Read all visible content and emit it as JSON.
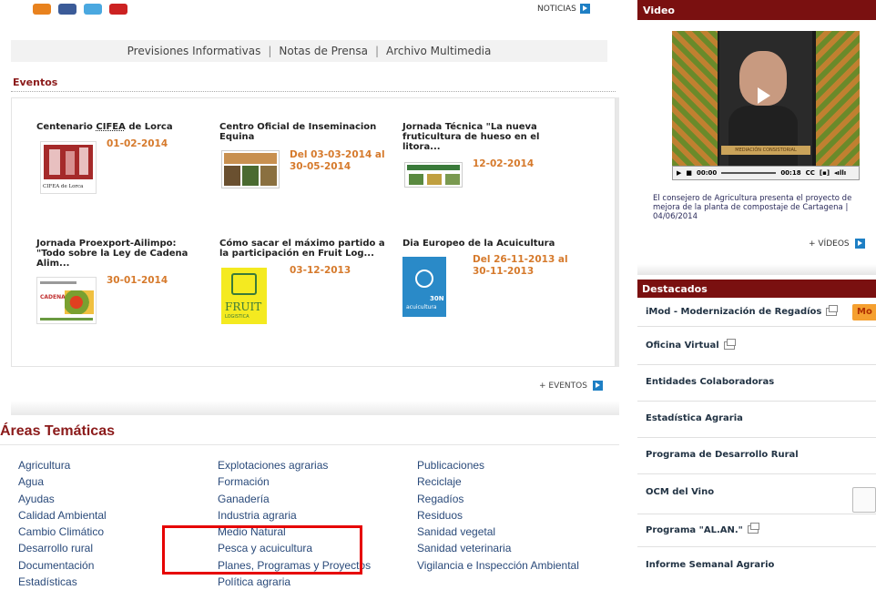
{
  "nav": {
    "items": [
      "Previsiones Informativas",
      "Notas de Prensa",
      "Archivo Multimedia"
    ],
    "sep": "|"
  },
  "top_right": {
    "label": "NOTICIAS"
  },
  "eventos": {
    "title": "Eventos",
    "items": [
      {
        "title_a": "Centenario ",
        "title_u": "CIFEA",
        "title_b": " de Lorca",
        "date": "01-02-2014"
      },
      {
        "title": "Centro Oficial de Inseminacion Equina",
        "date": "Del 03-03-2014 al 30-05-2014"
      },
      {
        "title": "Jornada Técnica \"La nueva fruticultura de hueso en el litora...",
        "date": "12-02-2014"
      },
      {
        "title": "Jornada Proexport-Ailimpo: \"Todo sobre la Ley de Cadena Alim...",
        "date": "30-01-2014"
      },
      {
        "title": "Cómo sacar el máximo partido a la participación en Fruit Log...",
        "date": "03-12-2013"
      },
      {
        "title": "Dia Europeo de la Acuicultura",
        "date": "Del 26-11-2013 al 30-11-2013"
      }
    ],
    "more": "+ EVENTOS"
  },
  "thumbs": {
    "cifea": "CIFEA de Lorca",
    "fruit": "FRUIT",
    "logistica": "LOGISTICA",
    "acui_num": "30N",
    "acui_word": "acuicultura",
    "cadena": "CADENA"
  },
  "areas": {
    "title": "Áreas Temáticas",
    "col1": [
      "Agricultura",
      "Agua",
      "Ayudas",
      "Calidad Ambiental",
      "Cambio Climático",
      "Desarrollo rural",
      "Documentación",
      "Estadísticas"
    ],
    "col2": [
      "Explotaciones agrarias",
      "Formación",
      "Ganadería",
      "Industria agraria",
      "Medio Natural",
      "Pesca y acuicultura",
      "Planes, Programas y Proyectos",
      "Política agraria"
    ],
    "col3": [
      "Publicaciones",
      "Reciclaje",
      "Regadíos",
      "Residuos",
      "Sanidad vegetal",
      "Sanidad veterinaria",
      "Vigilancia e Inspección Ambiental"
    ]
  },
  "video": {
    "header": "Video",
    "time_current": "00:00",
    "time_total": "00:18",
    "cc": "CC",
    "caption": "El consejero de Agricultura presenta el proyecto de mejora de la planta de compostaje de Cartagena  | 04/06/2014",
    "more": "+ VÍDEOS",
    "overlay": "MEDIACIÓN CONSISTORIAL"
  },
  "destacados": {
    "header": "Destacados",
    "items": [
      "iMod - Modernización de Regadíos",
      "Oficina Virtual",
      "Entidades Colaboradoras",
      "Estadística Agraria",
      "Programa de Desarrollo Rural",
      "OCM del Vino",
      "Programa \"AL.AN.\"",
      "Informe Semanal Agrario"
    ],
    "badge": "Mo"
  },
  "colors": {
    "header_bg": "#7a1010",
    "title_red": "#8b1a1a",
    "date_orange": "#d67a2c",
    "link_blue": "#2a4a7a",
    "highlight": "#e60000"
  }
}
